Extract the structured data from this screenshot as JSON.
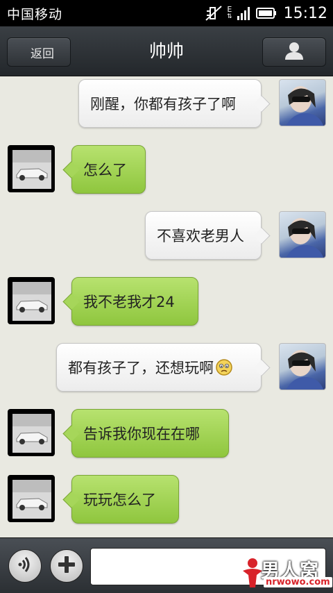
{
  "status_bar": {
    "carrier": "中国移动",
    "network": "E",
    "time": "15:12"
  },
  "header": {
    "back_label": "返回",
    "title": "帅帅"
  },
  "messages": [
    {
      "side": "out",
      "text": "刚醒，你都有孩子了啊"
    },
    {
      "side": "in",
      "text": "怎么了"
    },
    {
      "side": "out",
      "text": "不喜欢老男人"
    },
    {
      "side": "in",
      "text": "我不老我才24"
    },
    {
      "side": "out",
      "text": "都有孩子了，还想玩啊",
      "emoji": "sad-face-emoji"
    },
    {
      "side": "in",
      "text": "告诉我你现在在哪"
    },
    {
      "side": "in",
      "text": "玩玩怎么了"
    }
  ],
  "input_bar": {
    "message_value": ""
  },
  "watermark": {
    "brand": "男人窝",
    "site": "nrwowo.com"
  },
  "colors": {
    "incoming_bubble": "#a6d65a",
    "outgoing_bubble": "#f5f5f5",
    "chat_background": "#e9e9e1",
    "header": "#2e3236"
  }
}
